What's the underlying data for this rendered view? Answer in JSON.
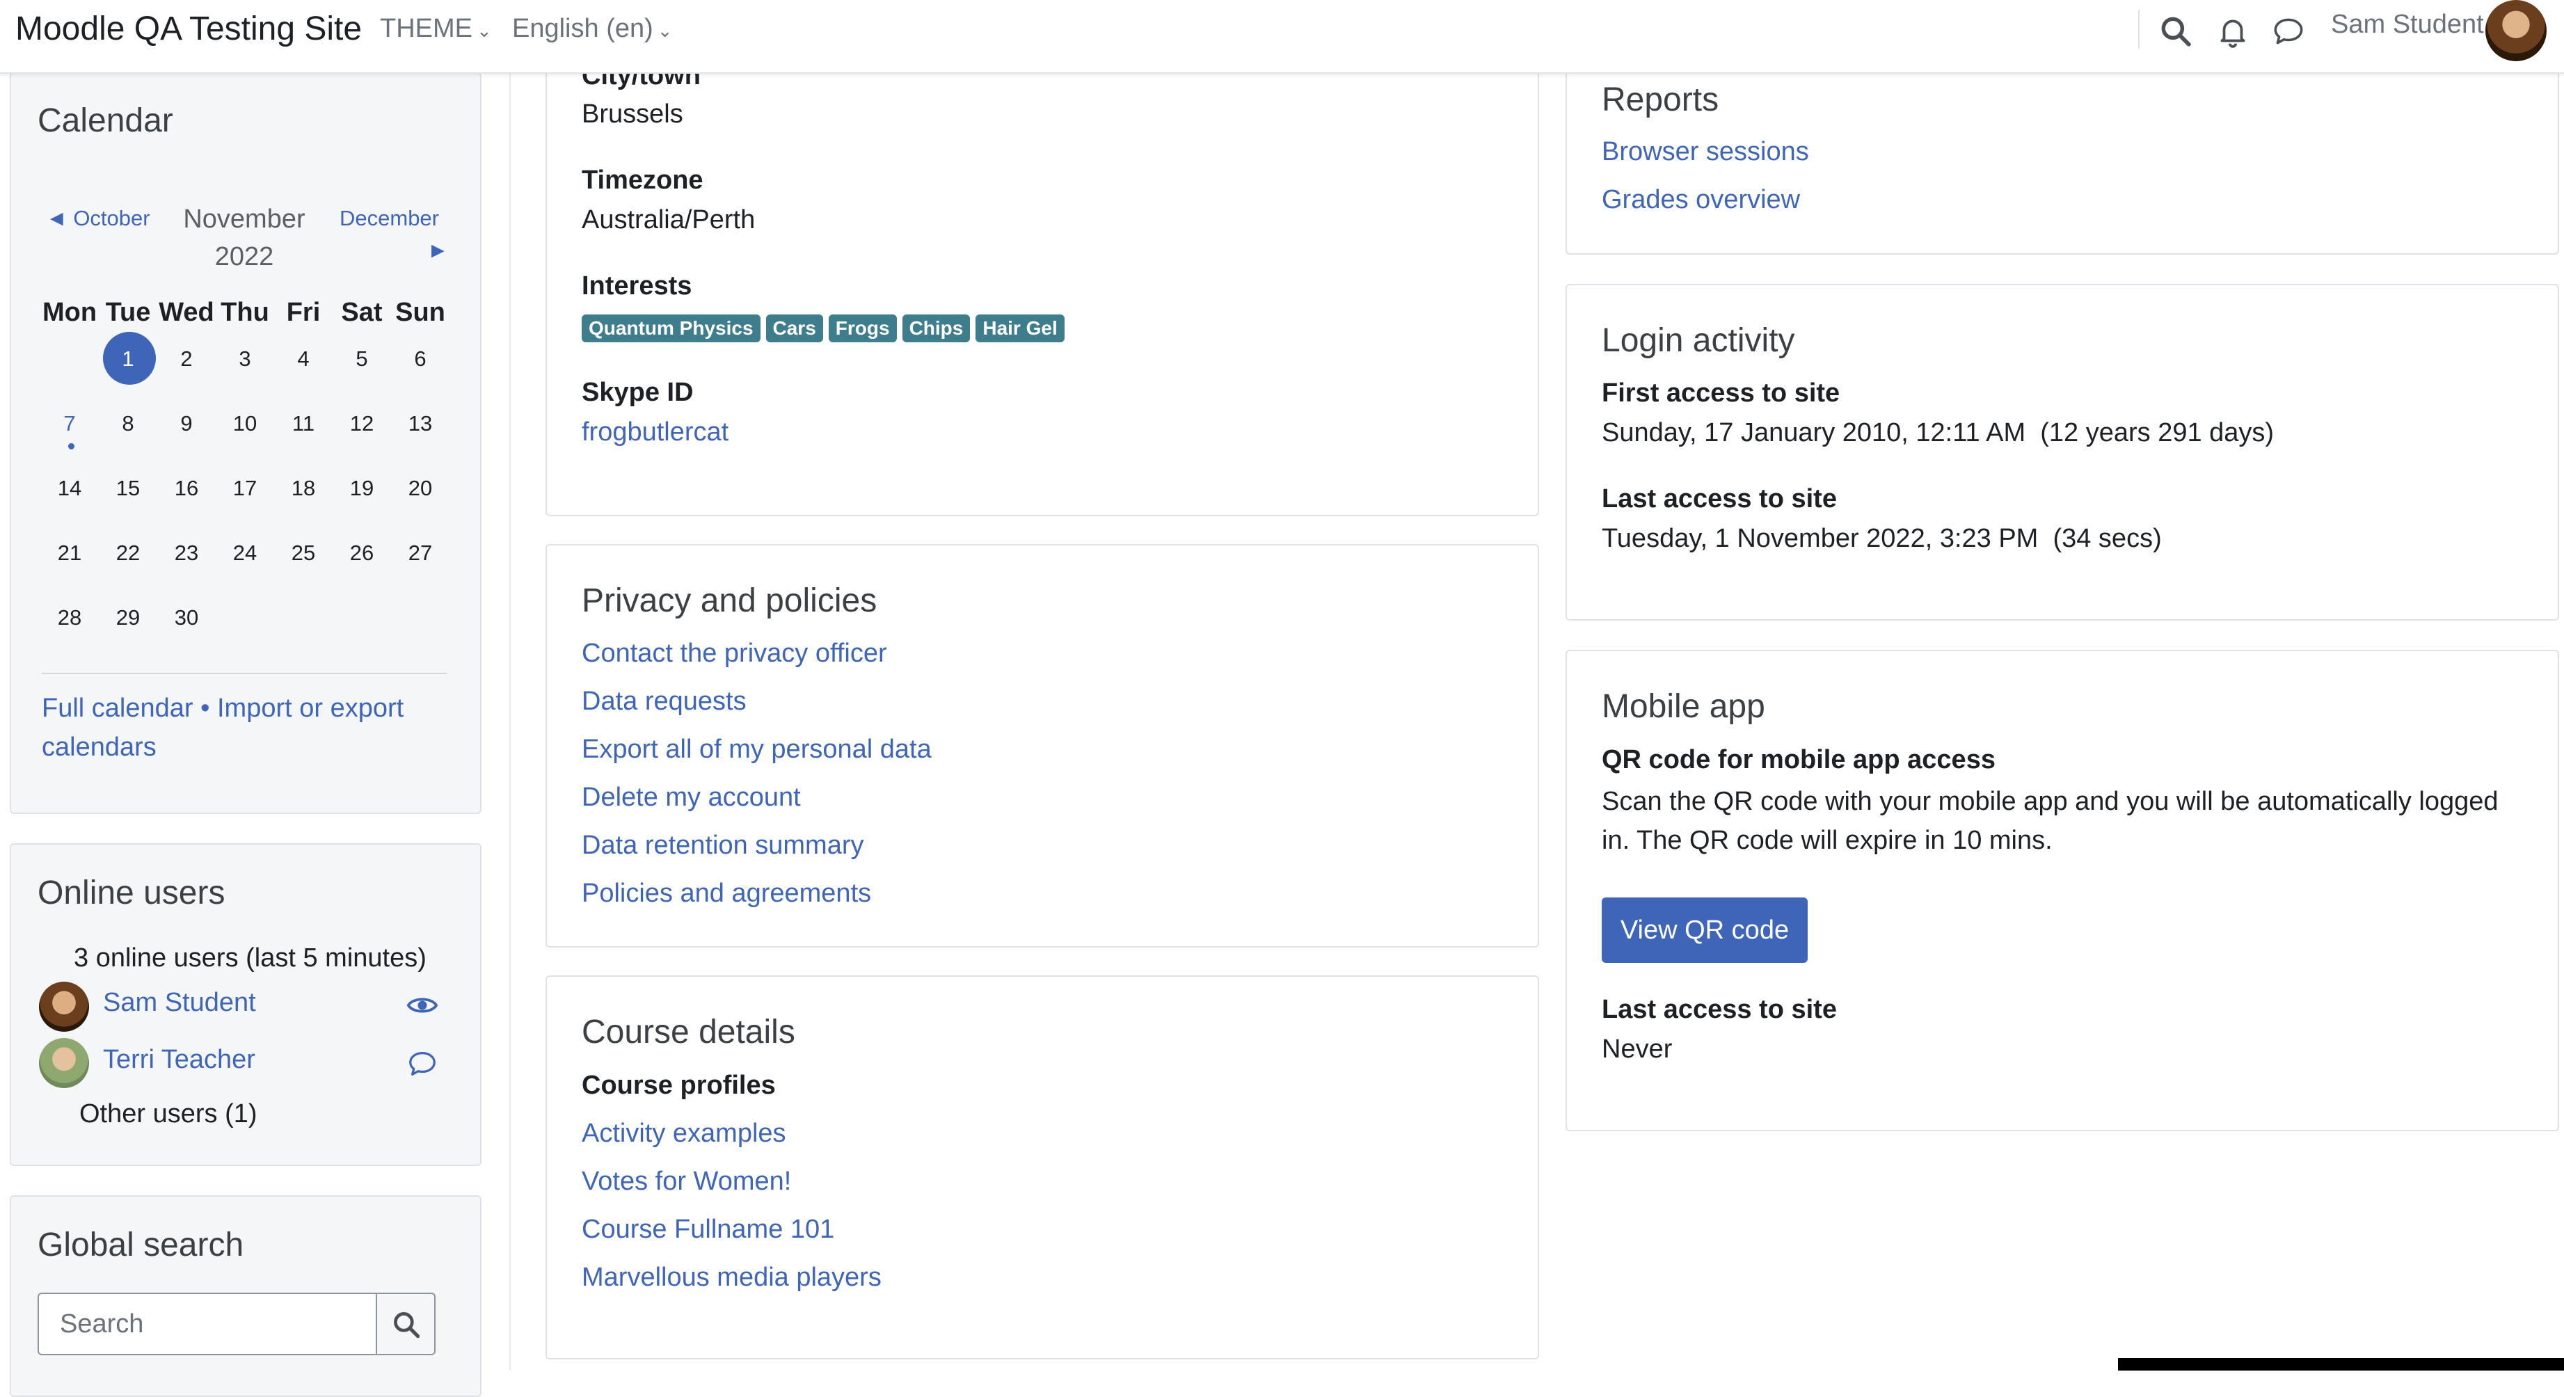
{
  "navbar": {
    "site_name": "Moodle QA Testing Site",
    "theme_label": "THEME",
    "language_label": "English (en)",
    "user_name": "Sam Student"
  },
  "calendar": {
    "title": "Calendar",
    "prev_month": "October",
    "next_month": "December",
    "current_month": "November",
    "current_year": "2022",
    "weekdays": [
      "Mon",
      "Tue",
      "Wed",
      "Thu",
      "Fri",
      "Sat",
      "Sun"
    ],
    "weeks": [
      [
        "",
        "1",
        "2",
        "3",
        "4",
        "5",
        "6"
      ],
      [
        "7",
        "8",
        "9",
        "10",
        "11",
        "12",
        "13"
      ],
      [
        "14",
        "15",
        "16",
        "17",
        "18",
        "19",
        "20"
      ],
      [
        "21",
        "22",
        "23",
        "24",
        "25",
        "26",
        "27"
      ],
      [
        "28",
        "29",
        "30",
        "",
        "",
        "",
        ""
      ]
    ],
    "today": "1",
    "event_day": "7",
    "full_calendar_link": "Full calendar",
    "separator": "•",
    "import_export_link": "Import or export calendars"
  },
  "online_users": {
    "title": "Online users",
    "count_text": "3 online users (last 5 minutes)",
    "users": [
      {
        "name": "Sam Student",
        "action_icon": "eye-icon"
      },
      {
        "name": "Terri Teacher",
        "action_icon": "message-icon"
      }
    ],
    "other_users": "Other users (1)"
  },
  "global_search": {
    "title": "Global search",
    "placeholder": "Search"
  },
  "profile": {
    "city_label": "City/town",
    "city_value": "Brussels",
    "timezone_label": "Timezone",
    "timezone_value": "Australia/Perth",
    "interests_label": "Interests",
    "interests": [
      "Quantum Physics",
      "Cars",
      "Frogs",
      "Chips",
      "Hair Gel"
    ],
    "skype_label": "Skype ID",
    "skype_value": "frogbutlercat"
  },
  "privacy": {
    "title": "Privacy and policies",
    "links": [
      "Contact the privacy officer",
      "Data requests",
      "Export all of my personal data",
      "Delete my account",
      "Data retention summary",
      "Policies and agreements"
    ]
  },
  "course_details": {
    "title": "Course details",
    "subtitle": "Course profiles",
    "links": [
      "Activity examples",
      "Votes for Women!",
      "Course Fullname 101",
      "Marvellous media players"
    ]
  },
  "reports": {
    "title": "Reports",
    "links": [
      "Browser sessions",
      "Grades overview"
    ]
  },
  "login_activity": {
    "title": "Login activity",
    "first_label": "First access to site",
    "first_value": "Sunday, 17 January 2010, 12:11 AM  (12 years 291 days)",
    "last_label": "Last access to site",
    "last_value": "Tuesday, 1 November 2022, 3:23 PM  (34 secs)"
  },
  "mobile_app": {
    "title": "Mobile app",
    "qr_label": "QR code for mobile app access",
    "qr_text": "Scan the QR code with your mobile app and you will be automatically logged in. The QR code will expire in 10 mins.",
    "button_label": "View QR code",
    "last_label": "Last access to site",
    "last_value": "Never"
  },
  "colors": {
    "link": "#3f65b8",
    "primary": "#3f65b8",
    "tag": "#3e7d8c",
    "block_bg": "#f5f6f8"
  }
}
